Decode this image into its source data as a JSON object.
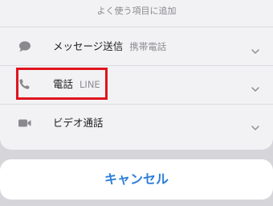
{
  "sheet": {
    "title": "よく使う項目に追加",
    "rows": [
      {
        "label": "メッセージ送信",
        "sublabel": "携帯電話",
        "icon": "message-bubble-icon"
      },
      {
        "label": "電話",
        "sublabel": "LINE",
        "icon": "phone-icon"
      },
      {
        "label": "ビデオ通話",
        "sublabel": "",
        "icon": "video-camera-icon"
      }
    ]
  },
  "cancel_label": "キャンセル",
  "colors": {
    "accent": "#2e7fd8",
    "highlight": "#e0141e",
    "icon": "#8a8a8e"
  }
}
